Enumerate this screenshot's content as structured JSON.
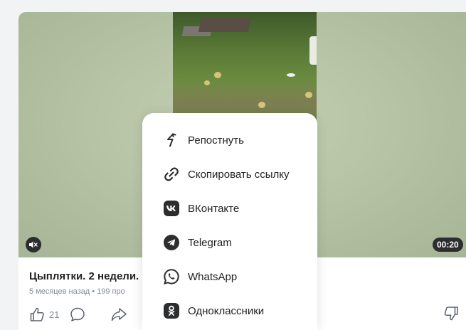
{
  "video": {
    "duration": "00:20",
    "title": "Цыплятки. 2 недели.",
    "meta": "5 месяцев назад • 199 про",
    "like_count": "21"
  },
  "share_menu": {
    "items": [
      {
        "label": "Репостнуть",
        "icon": "repost-icon"
      },
      {
        "label": "Скопировать ссылку",
        "icon": "link-icon"
      },
      {
        "label": "ВКонтакте",
        "icon": "vk-icon"
      },
      {
        "label": "Telegram",
        "icon": "telegram-icon"
      },
      {
        "label": "WhatsApp",
        "icon": "whatsapp-icon"
      },
      {
        "label": "Одноклассники",
        "icon": "odnoklassniki-icon"
      }
    ]
  },
  "colors": {
    "icon_dark": "#2c2d2e",
    "meta_text": "#818c99",
    "popup_bg": "#ffffff"
  }
}
